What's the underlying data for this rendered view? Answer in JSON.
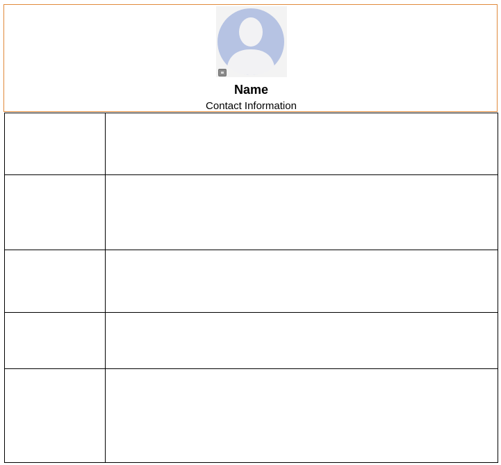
{
  "profile": {
    "name": "Name",
    "contact": "Contact Information",
    "avatar_icon": "default-user-silhouette",
    "avatar_bg_color": "#b4c4e4",
    "accent_border_color": "#e08a3a"
  },
  "sections": [
    {
      "label": "",
      "content": ""
    },
    {
      "label": "",
      "content": ""
    },
    {
      "label": "",
      "content": ""
    },
    {
      "label": "",
      "content": ""
    },
    {
      "label": "",
      "content": ""
    }
  ]
}
